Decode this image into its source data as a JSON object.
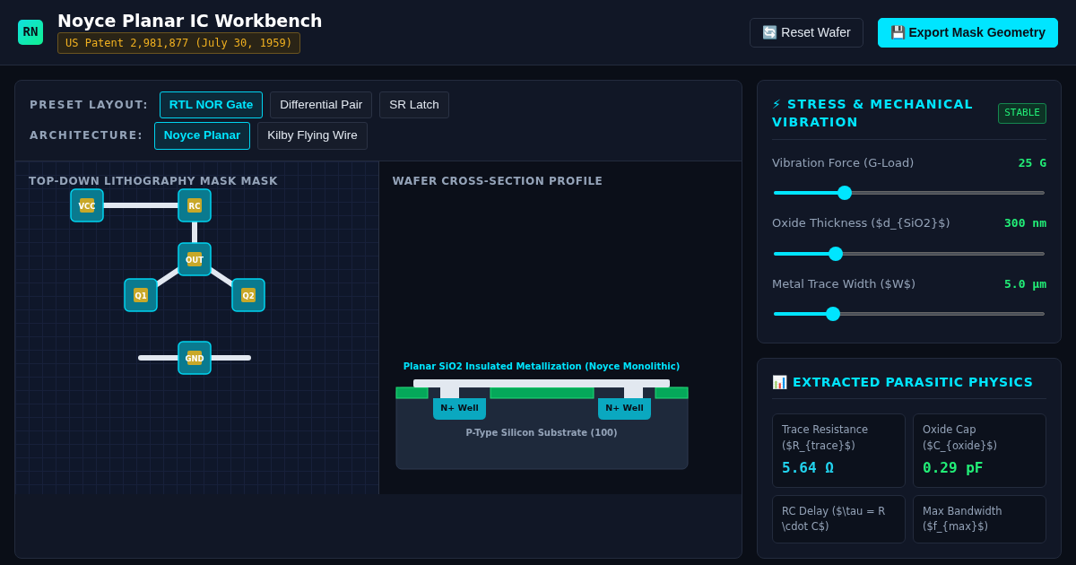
{
  "header": {
    "logo": "RN",
    "title": "Noyce Planar IC Workbench",
    "patent": "US Patent 2,981,877 (July 30, 1959)",
    "buttons": [
      {
        "kind": "secondary",
        "icon": "🔄",
        "label": "Reset Wafer"
      },
      {
        "kind": "primary",
        "icon": "💾",
        "label": "Export Mask Geometry"
      }
    ]
  },
  "controls": [
    {
      "label": "PRESET LAYOUT:",
      "options": [
        {
          "label": "RTL NOR Gate",
          "selected": true
        },
        {
          "label": "Differential Pair",
          "selected": false
        },
        {
          "label": "SR Latch",
          "selected": false
        }
      ]
    },
    {
      "label": "ARCHITECTURE:",
      "options": [
        {
          "label": "Noyce Planar",
          "selected": true
        },
        {
          "label": "Kilby Flying Wire",
          "selected": false
        }
      ]
    }
  ],
  "mask_view": {
    "title": "TOP-DOWN LITHOGRAPHY MASK MASK",
    "nodes": [
      "VCC",
      "RC",
      "OUT",
      "Q1",
      "Q2",
      "GND"
    ]
  },
  "cross_section": {
    "title": "WAFER CROSS-SECTION PROFILE",
    "caption": "Planar SiO2 Insulated Metallization (Noyce Monolithic)",
    "wells": [
      "N+ Well",
      "N+ Well"
    ],
    "substrate": "P-Type Silicon Substrate (100)"
  },
  "stress": {
    "icon": "⚡",
    "title": "STRESS & MECHANICAL VIBRATION",
    "status": "STABLE",
    "sliders": [
      {
        "label": "Vibration Force (G-Load)",
        "reading": "25 G",
        "level": 0.26
      },
      {
        "label": "Oxide Thickness ($d_{SiO2}$)",
        "reading": "300 nm",
        "level": 0.23
      },
      {
        "label": "Metal Trace Width ($W$)",
        "reading": "5.0 µm",
        "level": 0.22
      }
    ]
  },
  "parasitics": {
    "icon": "📊",
    "title": "EXTRACTED PARASITIC PHYSICS",
    "metrics": [
      {
        "label": "Trace Resistance ($R_{trace}$)",
        "value": "5.64 Ω",
        "color": "#22d3ee"
      },
      {
        "label": "Oxide Cap ($C_{oxide}$)",
        "value": "0.29 pF",
        "color": "#22ee77"
      },
      {
        "label": "RC Delay ($\\tau = R \\cdot C$)"
      },
      {
        "label": "Max Bandwidth ($f_{max}$)"
      }
    ]
  }
}
